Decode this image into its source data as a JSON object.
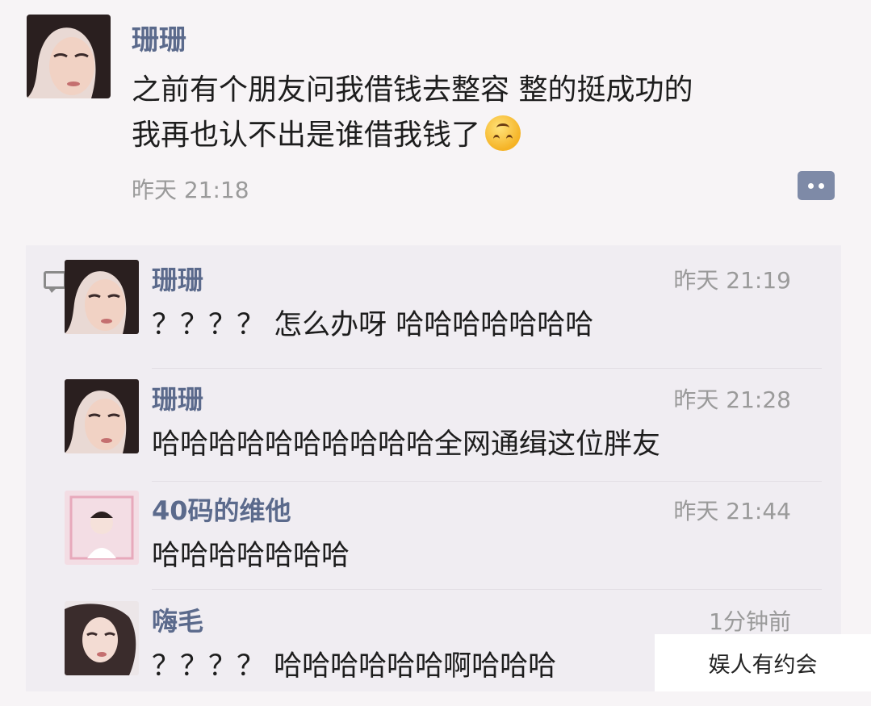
{
  "post": {
    "author": "珊珊",
    "text_line1": "之前有个朋友问我借钱去整容 整的挺成功的",
    "text_line2": "我再也认不出是谁借我钱了",
    "emoji_icon": "upside-down-face-icon",
    "time": "昨天 21:18"
  },
  "comments": [
    {
      "name": "珊珊",
      "time": "昨天 21:19",
      "text": "？？？？ 怎么办呀 哈哈哈哈哈哈哈"
    },
    {
      "name": "珊珊",
      "time": "昨天 21:28",
      "text": "哈哈哈哈哈哈哈哈哈哈全网通缉这位胖友"
    },
    {
      "name": "40码的维他",
      "time": "昨天 21:44",
      "text": "哈哈哈哈哈哈哈"
    },
    {
      "name": "嗨毛",
      "time": "1分钟前",
      "text": "？？？？ 哈哈哈哈哈哈啊哈哈哈"
    }
  ],
  "watermark": "娱人有约会",
  "colors": {
    "name": "#5b6a8c",
    "time": "#9a9a9a",
    "panel": "#f0edf2",
    "more_button": "#7e8aa7"
  }
}
